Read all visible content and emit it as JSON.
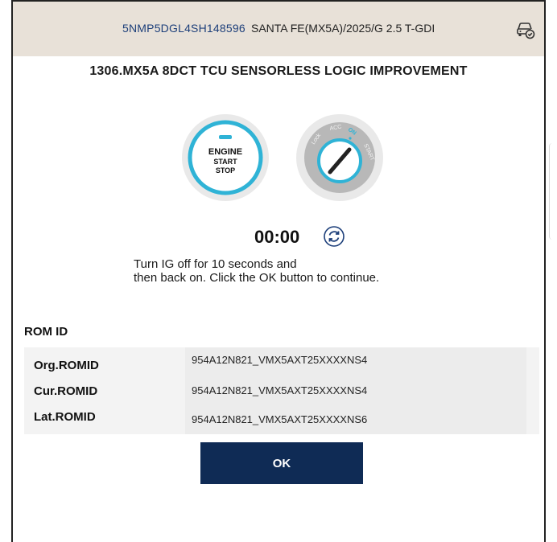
{
  "header": {
    "vin": "5NMP5DGL4SH148596",
    "model": "SANTA FE(MX5A)/2025/G 2.5 T-GDI",
    "icon": "vehicle-check-icon"
  },
  "title": "1306.MX5A 8DCT TCU SENSORLESS LOGIC IMPROVEMENT",
  "engine_button": {
    "line1": "ENGINE",
    "line2": "START",
    "line3": "STOP"
  },
  "ignition": {
    "lock": "Lock",
    "acc": "ACC",
    "on": "ON",
    "start": "START"
  },
  "timer": {
    "value": "00:00",
    "icon": "refresh-icon"
  },
  "instruction": {
    "line1": "Turn IG off for 10 seconds and",
    "line2": "then back on. Click the OK button to continue."
  },
  "rom": {
    "section_title": "ROM ID",
    "rows": [
      {
        "name": "Org.ROMID",
        "value": "954A12N821_VMX5AXT25XXXXNS4"
      },
      {
        "name": "Cur.ROMID",
        "value": "954A12N821_VMX5AXT25XXXXNS4"
      },
      {
        "name": "Lat.ROMID",
        "value": "954A12N821_VMX5AXT25XXXXNS6"
      }
    ]
  },
  "ok_label": "OK",
  "colors": {
    "header_bg": "#e8e1d8",
    "accent_cyan": "#2fb3d6",
    "button_navy": "#0f2b55",
    "vin_blue": "#1d3f7a"
  }
}
